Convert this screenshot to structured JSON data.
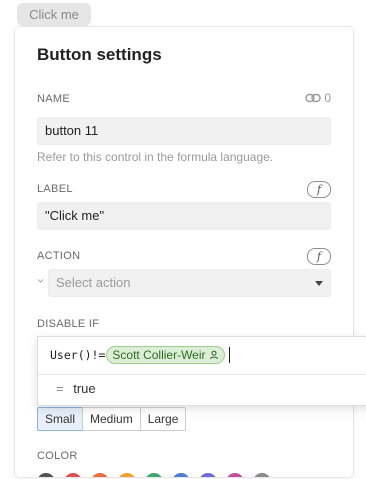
{
  "preview_button": {
    "label": "Click me"
  },
  "panel": {
    "title": "Button settings",
    "name": {
      "label": "NAME",
      "link_count": "0",
      "value": "button 11",
      "hint": "Refer to this control in the formula language."
    },
    "label": {
      "label": "LABEL",
      "value": "\"Click me\""
    },
    "action": {
      "label": "ACTION",
      "placeholder": "Select action"
    },
    "disable_if": {
      "label": "DISABLE IF"
    },
    "formula_icon": "f",
    "sizes": [
      "Small",
      "Medium",
      "Large"
    ],
    "selected_size": "Small",
    "color": {
      "label": "COLOR",
      "swatches": [
        "#555555",
        "#d9534f",
        "#e8703a",
        "#f0a030",
        "#3fa66b",
        "#4a7fd6",
        "#6b6bd6",
        "#c04fa0",
        "#8a8a8a"
      ]
    }
  },
  "formula_popup": {
    "prefix": "User()!=",
    "user_chip": "Scott Collier-Weir",
    "result_symbol": "=",
    "result_value": "true"
  },
  "colors": {
    "accent": "#89b2dc",
    "chip_bg": "#dcefd6",
    "chip_text": "#2d6b24"
  }
}
